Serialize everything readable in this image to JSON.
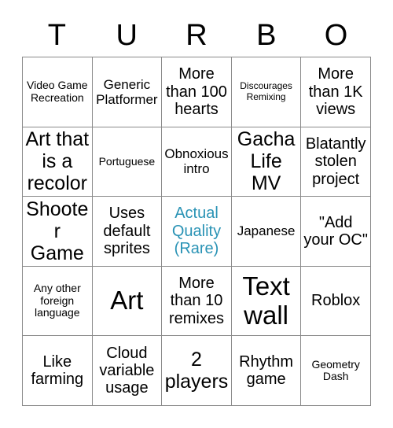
{
  "card": {
    "header_letters": [
      "T",
      "U",
      "R",
      "B",
      "O"
    ],
    "accent_color": "#2a93b5",
    "grid_line_color": "#8a8a8a",
    "text_color": "#000000",
    "background_color": "#ffffff",
    "rows": 5,
    "columns": 5,
    "cells": [
      {
        "text": "Video Game Recreation",
        "size": "sz-s",
        "accent": false
      },
      {
        "text": "Generic Platformer",
        "size": "sz-m",
        "accent": false
      },
      {
        "text": "More than 100 hearts",
        "size": "sz-l",
        "accent": false
      },
      {
        "text": "Discourages Remixing",
        "size": "sz-xs",
        "accent": false
      },
      {
        "text": "More than 1K views",
        "size": "sz-l",
        "accent": false
      },
      {
        "text": "Art that is a recolor",
        "size": "sz-xl",
        "accent": false
      },
      {
        "text": "Portuguese",
        "size": "sz-s",
        "accent": false
      },
      {
        "text": "Obnoxious intro",
        "size": "sz-m",
        "accent": false
      },
      {
        "text": "Gacha Life MV",
        "size": "sz-xl",
        "accent": false
      },
      {
        "text": "Blatantly stolen project",
        "size": "sz-l",
        "accent": false
      },
      {
        "text": "Shooter Game",
        "size": "sz-xl",
        "accent": false
      },
      {
        "text": "Uses default sprites",
        "size": "sz-l",
        "accent": false
      },
      {
        "text": "Actual Quality (Rare)",
        "size": "sz-l",
        "accent": true
      },
      {
        "text": "Japanese",
        "size": "sz-m",
        "accent": false
      },
      {
        "text": "\"Add your OC\"",
        "size": "sz-l",
        "accent": false
      },
      {
        "text": "Any other foreign language",
        "size": "sz-s",
        "accent": false
      },
      {
        "text": "Art",
        "size": "sz-xxl",
        "accent": false
      },
      {
        "text": "More than 10 remixes",
        "size": "sz-l",
        "accent": false
      },
      {
        "text": "Text wall",
        "size": "sz-xxl",
        "accent": false
      },
      {
        "text": "Roblox",
        "size": "sz-l",
        "accent": false
      },
      {
        "text": "Like farming",
        "size": "sz-l",
        "accent": false
      },
      {
        "text": "Cloud variable usage",
        "size": "sz-l",
        "accent": false
      },
      {
        "text": "2 players",
        "size": "sz-xl",
        "accent": false
      },
      {
        "text": "Rhythm game",
        "size": "sz-l",
        "accent": false
      },
      {
        "text": "Geometry Dash",
        "size": "sz-s",
        "accent": false
      }
    ]
  }
}
